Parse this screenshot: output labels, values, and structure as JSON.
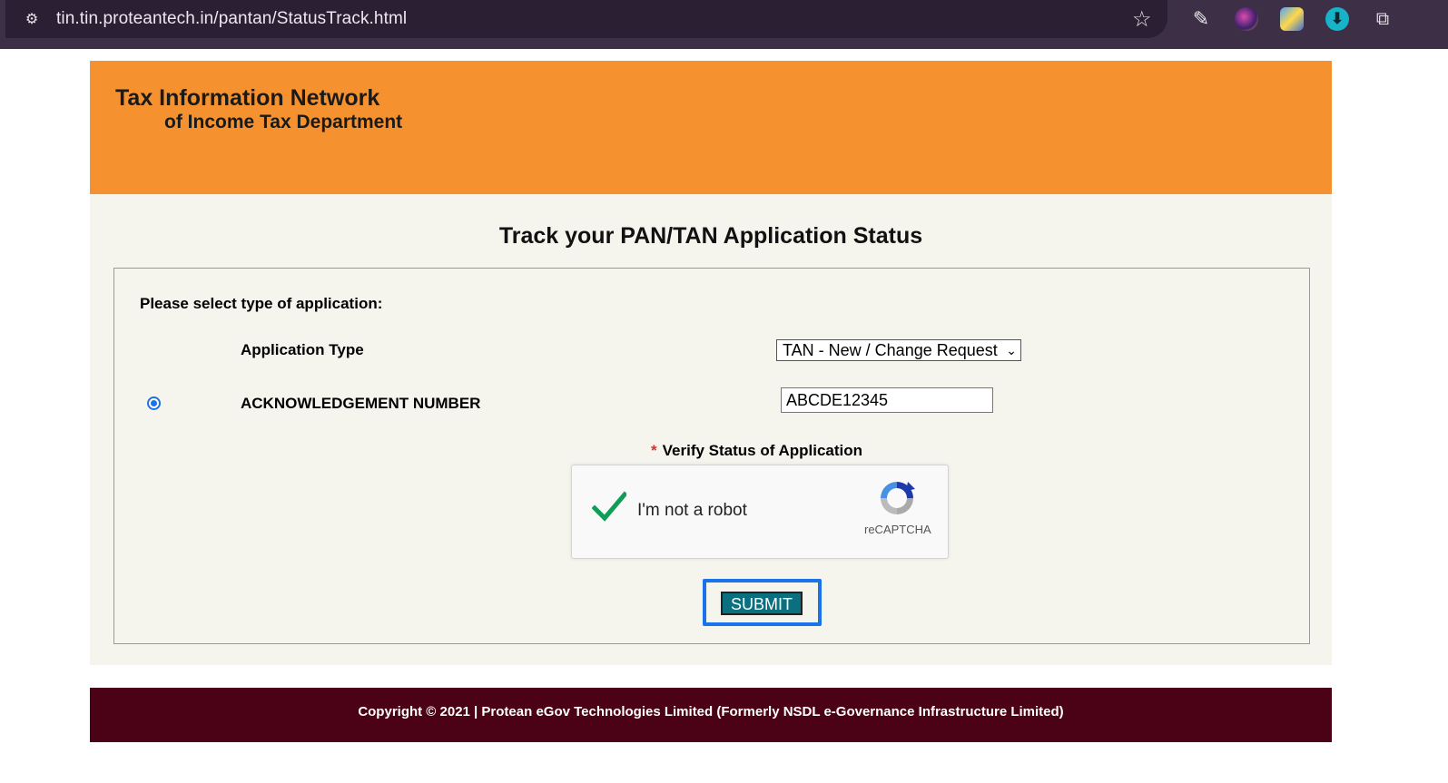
{
  "browser": {
    "url": "tin.tin.proteantech.in/pantan/StatusTrack.html",
    "icons": [
      "site-info-icon",
      "bookmark-star-icon",
      "eyedropper-icon",
      "extension-icon",
      "extension-icon",
      "download-icon",
      "extensions-puzzle-icon"
    ]
  },
  "header": {
    "title_line1": "Tax Information Network",
    "title_line2": "of Income Tax Department",
    "bg_color": "#f5922f"
  },
  "main": {
    "page_title": "Track your PAN/TAN Application Status",
    "select_prompt": "Please select type of application:",
    "application_type_label": "Application Type",
    "application_type_value": "TAN - New / Change Request",
    "acknowledgement_label": "ACKNOWLEDGEMENT NUMBER",
    "acknowledgement_value": "ABCDE12345",
    "acknowledgement_selected": true,
    "verify_required_mark": "*",
    "verify_label": "Verify Status of Application",
    "captcha_text": "I'm not a robot",
    "captcha_brand": "reCAPTCHA",
    "captcha_checked": true,
    "submit_label": "SUBMIT"
  },
  "footer": {
    "copyright": "Copyright © 2021 | Protean eGov Technologies Limited (Formerly NSDL e-Governance Infrastructure Limited)",
    "bg_color": "#4b0116"
  }
}
